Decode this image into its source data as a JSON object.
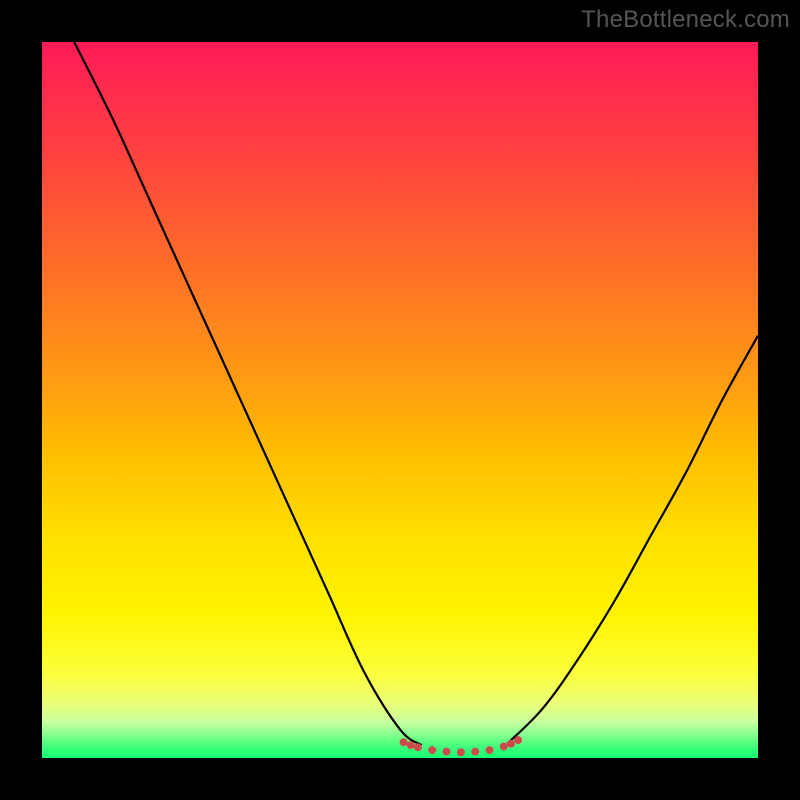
{
  "watermark": "TheBottleneck.com",
  "colors": {
    "frame": "#000000",
    "curve": "#000000",
    "dots": "#cf4a4a",
    "gradient_stops": [
      "#ff1a57",
      "#ff4040",
      "#ff6a2a",
      "#ff9515",
      "#ffbf00",
      "#ffe200",
      "#fff400",
      "#fcff3a",
      "#eaff7a",
      "#c6ffa0",
      "#7aff8a",
      "#2bff78",
      "#18ff72"
    ]
  },
  "chart_data": {
    "type": "line",
    "title": "",
    "xlabel": "",
    "ylabel": "",
    "xlim": [
      0,
      1
    ],
    "ylim": [
      0,
      1
    ],
    "series": [
      {
        "name": "left-curve",
        "x": [
          0.045,
          0.1,
          0.15,
          0.2,
          0.25,
          0.3,
          0.35,
          0.4,
          0.45,
          0.5,
          0.53
        ],
        "y": [
          1.0,
          0.89,
          0.78,
          0.67,
          0.56,
          0.45,
          0.34,
          0.23,
          0.12,
          0.04,
          0.018
        ]
      },
      {
        "name": "right-curve",
        "x": [
          0.65,
          0.7,
          0.75,
          0.8,
          0.85,
          0.9,
          0.95,
          1.0
        ],
        "y": [
          0.02,
          0.07,
          0.14,
          0.22,
          0.31,
          0.4,
          0.5,
          0.59
        ]
      },
      {
        "name": "floor-dots",
        "x": [
          0.525,
          0.545,
          0.565,
          0.585,
          0.605,
          0.625,
          0.645
        ],
        "y": [
          0.015,
          0.011,
          0.009,
          0.008,
          0.009,
          0.011,
          0.016
        ]
      },
      {
        "name": "floor-dots-left",
        "x": [
          0.505,
          0.515
        ],
        "y": [
          0.022,
          0.018
        ]
      },
      {
        "name": "floor-dots-right",
        "x": [
          0.655,
          0.665
        ],
        "y": [
          0.02,
          0.025
        ]
      }
    ]
  }
}
